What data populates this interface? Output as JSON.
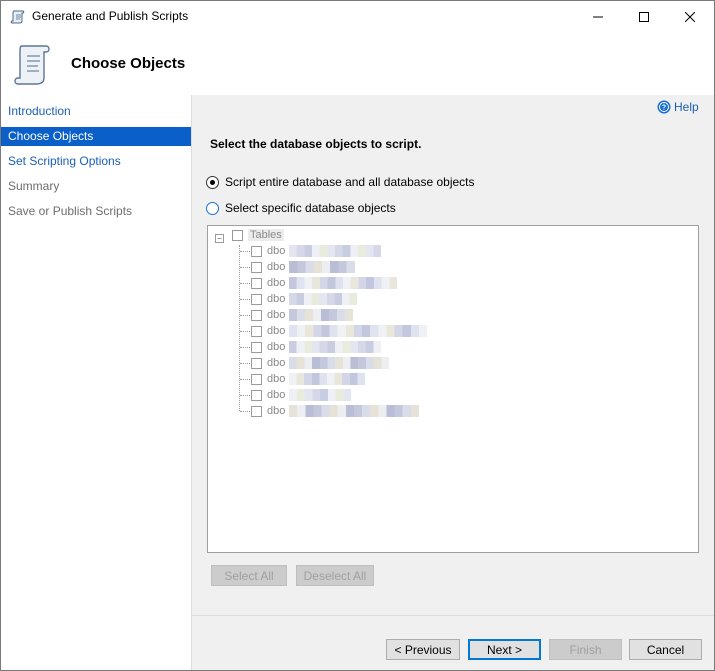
{
  "window": {
    "title": "Generate and Publish Scripts"
  },
  "header": {
    "title": "Choose Objects"
  },
  "sidebar": {
    "items": [
      {
        "label": "Introduction",
        "state": "link"
      },
      {
        "label": "Choose Objects",
        "state": "active"
      },
      {
        "label": "Set Scripting Options",
        "state": "link"
      },
      {
        "label": "Summary",
        "state": "disabled"
      },
      {
        "label": "Save or Publish Scripts",
        "state": "disabled"
      }
    ]
  },
  "main": {
    "help_label": "Help",
    "instruction": "Select the database objects to script.",
    "options": [
      {
        "label": "Script entire database and all database objects",
        "checked": true
      },
      {
        "label": "Select specific database objects",
        "checked": false
      }
    ],
    "tree": {
      "root_label": "Tables",
      "items": [
        "dbo",
        "dbo",
        "dbo",
        "dbo",
        "dbo",
        "dbo",
        "dbo",
        "dbo",
        "dbo",
        "dbo",
        "dbo"
      ]
    },
    "select_all_label": "Select All",
    "deselect_all_label": "Deselect All"
  },
  "footer": {
    "previous_label": "< Previous",
    "next_label": "Next >",
    "finish_label": "Finish",
    "cancel_label": "Cancel"
  },
  "colors": {
    "accent": "#0a60c8",
    "link": "#1a5fb4",
    "panel": "#f0f0f0"
  }
}
